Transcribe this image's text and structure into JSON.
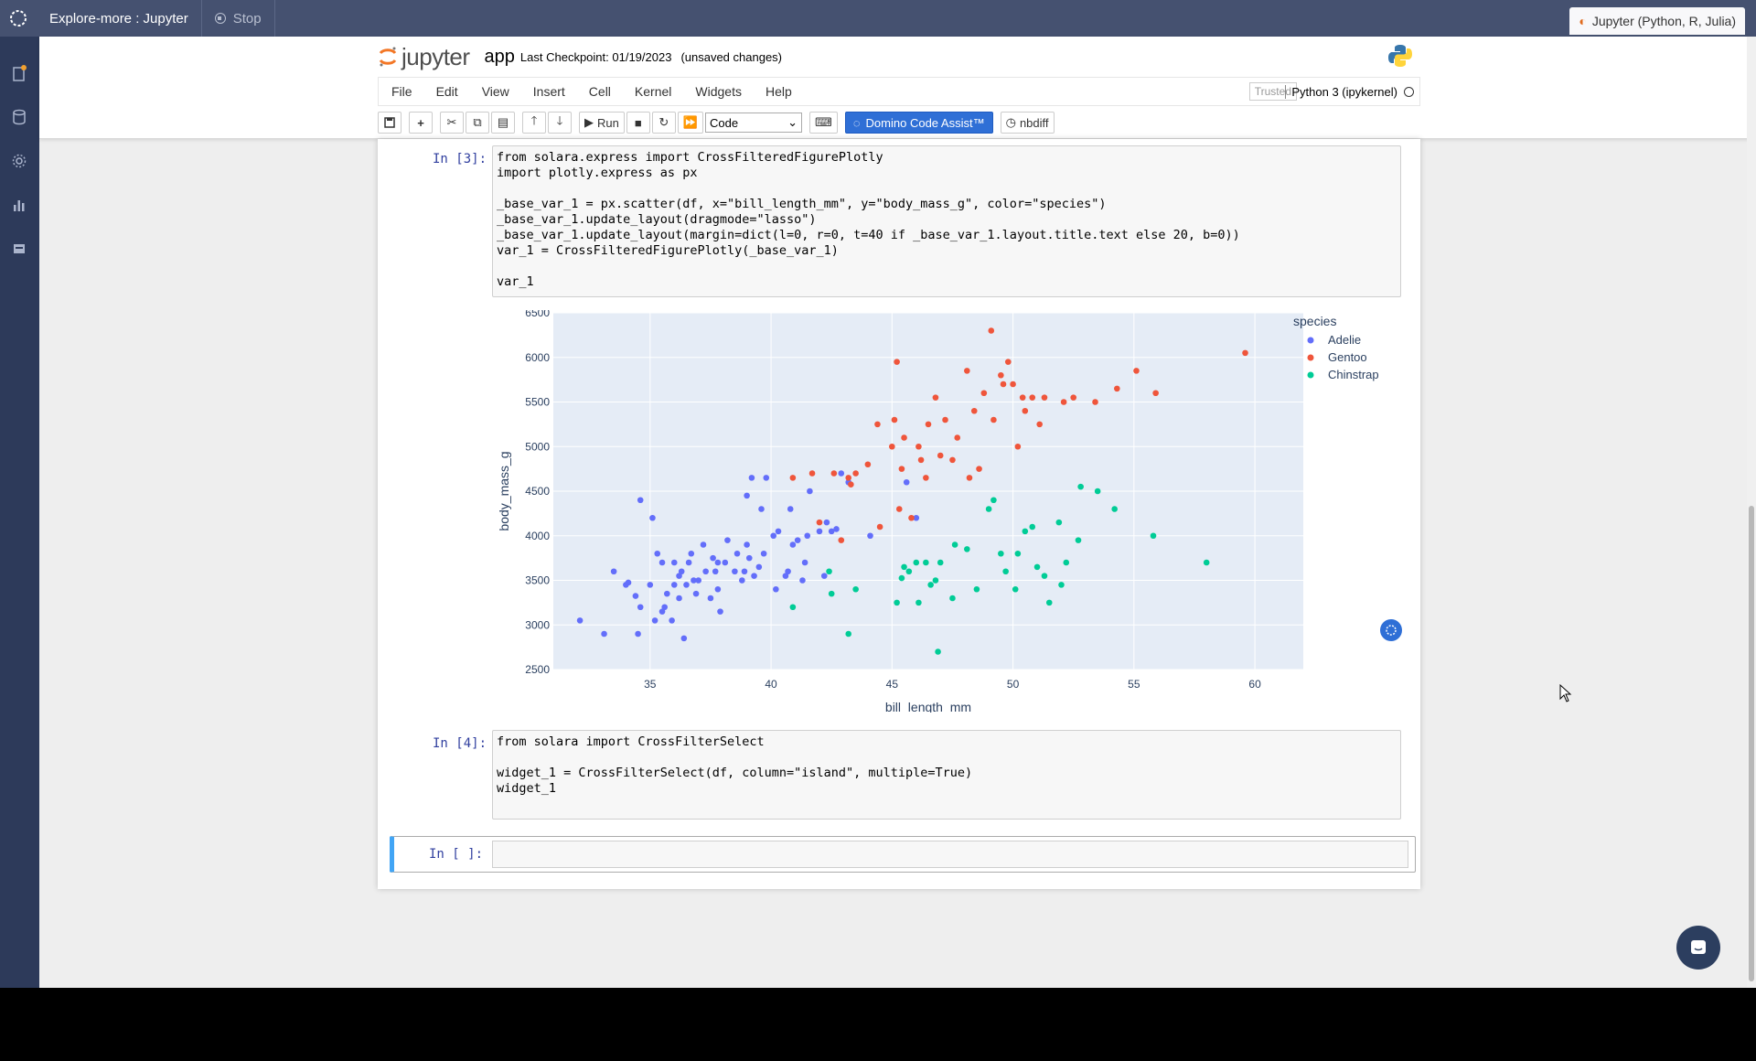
{
  "topbar": {
    "title": "Explore-more : Jupyter",
    "stop_label": "Stop",
    "env_label": "Jupyter (Python, R, Julia)"
  },
  "header": {
    "notebook_name": "app",
    "jupyter_text": "jupyter",
    "checkpoint": "Last Checkpoint: 01/19/2023",
    "status": "(unsaved changes)"
  },
  "menu": {
    "items": [
      "File",
      "Edit",
      "View",
      "Insert",
      "Cell",
      "Kernel",
      "Widgets",
      "Help"
    ],
    "trusted": "Trusted",
    "kernel": "Python 3 (ipykernel)"
  },
  "toolbar": {
    "run_label": "Run",
    "cell_type": "Code",
    "domino_label": "Domino Code Assist™",
    "nbdiff_label": "nbdiff"
  },
  "cells": [
    {
      "prompt": "In [3]:",
      "lines": [
        "from solara.express import CrossFilteredFigurePlotly",
        "import plotly.express as px",
        "",
        "_base_var_1 = px.scatter(df, x=\"bill_length_mm\", y=\"body_mass_g\", color=\"species\")",
        "_base_var_1.update_layout(dragmode=\"lasso\")",
        "_base_var_1.update_layout(margin=dict(l=0, r=0, t=40 if _base_var_1.layout.title.text else 20, b=0))",
        "var_1 = CrossFilteredFigurePlotly(_base_var_1)",
        "",
        "var_1"
      ]
    },
    {
      "prompt": "In [4]:",
      "lines": [
        "from solara import CrossFilterSelect",
        "",
        "widget_1 = CrossFilterSelect(df, column=\"island\", multiple=True)",
        "widget_1"
      ]
    },
    {
      "prompt": "In [ ]:",
      "lines": []
    }
  ],
  "chart_data": {
    "type": "scatter",
    "xlabel": "bill_length_mm",
    "ylabel": "body_mass_g",
    "xlim": [
      31,
      62
    ],
    "ylim": [
      2500,
      6500
    ],
    "xticks": [
      35,
      40,
      45,
      50,
      55,
      60
    ],
    "yticks": [
      2500,
      3000,
      3500,
      4000,
      4500,
      5000,
      5500,
      6000,
      6500
    ],
    "legend_title": "species",
    "legend_position": "right",
    "grid": true,
    "series": [
      {
        "name": "Adelie",
        "color": "#636efa",
        "points": [
          [
            32.1,
            3050
          ],
          [
            33.1,
            2900
          ],
          [
            33.5,
            3600
          ],
          [
            34.0,
            3450
          ],
          [
            34.1,
            3475
          ],
          [
            34.4,
            3325
          ],
          [
            34.5,
            2900
          ],
          [
            34.6,
            4400
          ],
          [
            34.6,
            3200
          ],
          [
            35.0,
            3450
          ],
          [
            35.1,
            4200
          ],
          [
            35.2,
            3050
          ],
          [
            35.3,
            3800
          ],
          [
            35.5,
            3700
          ],
          [
            35.5,
            3150
          ],
          [
            35.6,
            3200
          ],
          [
            35.7,
            3350
          ],
          [
            35.9,
            3050
          ],
          [
            36.0,
            3700
          ],
          [
            36.0,
            3450
          ],
          [
            36.2,
            3300
          ],
          [
            36.2,
            3550
          ],
          [
            36.3,
            3600
          ],
          [
            36.4,
            2850
          ],
          [
            36.5,
            3450
          ],
          [
            36.6,
            3700
          ],
          [
            36.7,
            3800
          ],
          [
            36.8,
            3500
          ],
          [
            36.9,
            3350
          ],
          [
            37.0,
            3500
          ],
          [
            37.2,
            3900
          ],
          [
            37.3,
            3600
          ],
          [
            37.5,
            3300
          ],
          [
            37.6,
            3750
          ],
          [
            37.7,
            3600
          ],
          [
            37.8,
            3700
          ],
          [
            37.8,
            3400
          ],
          [
            37.9,
            3150
          ],
          [
            38.1,
            3700
          ],
          [
            38.2,
            3950
          ],
          [
            38.5,
            3600
          ],
          [
            38.6,
            3800
          ],
          [
            38.8,
            3500
          ],
          [
            38.9,
            3600
          ],
          [
            39.0,
            3900
          ],
          [
            39.0,
            4450
          ],
          [
            39.1,
            3750
          ],
          [
            39.2,
            4650
          ],
          [
            39.3,
            3550
          ],
          [
            39.5,
            3650
          ],
          [
            39.6,
            4300
          ],
          [
            39.7,
            3800
          ],
          [
            39.8,
            4650
          ],
          [
            40.1,
            4000
          ],
          [
            40.2,
            3400
          ],
          [
            40.3,
            4050
          ],
          [
            40.6,
            3550
          ],
          [
            40.7,
            3600
          ],
          [
            40.8,
            4300
          ],
          [
            40.9,
            3900
          ],
          [
            41.1,
            3950
          ],
          [
            41.3,
            3500
          ],
          [
            41.4,
            3700
          ],
          [
            41.5,
            4000
          ],
          [
            41.6,
            4500
          ],
          [
            42.0,
            4050
          ],
          [
            42.2,
            3550
          ],
          [
            42.3,
            4150
          ],
          [
            42.5,
            4050
          ],
          [
            42.7,
            4075
          ],
          [
            42.9,
            4700
          ],
          [
            43.2,
            4600
          ],
          [
            44.1,
            4000
          ],
          [
            45.6,
            4600
          ],
          [
            46.0,
            4200
          ]
        ]
      },
      {
        "name": "Gentoo",
        "color": "#ef553b",
        "points": [
          [
            40.9,
            4650
          ],
          [
            41.7,
            4700
          ],
          [
            42.0,
            4150
          ],
          [
            42.6,
            4700
          ],
          [
            42.9,
            3950
          ],
          [
            43.2,
            4650
          ],
          [
            43.3,
            4575
          ],
          [
            43.5,
            4700
          ],
          [
            44.0,
            4800
          ],
          [
            44.4,
            5250
          ],
          [
            44.5,
            4100
          ],
          [
            45.0,
            5000
          ],
          [
            45.1,
            5300
          ],
          [
            45.2,
            5950
          ],
          [
            45.3,
            4300
          ],
          [
            45.4,
            4750
          ],
          [
            45.5,
            5100
          ],
          [
            45.8,
            4200
          ],
          [
            46.1,
            5000
          ],
          [
            46.2,
            4850
          ],
          [
            46.4,
            4650
          ],
          [
            46.5,
            5250
          ],
          [
            46.8,
            5550
          ],
          [
            47.0,
            4900
          ],
          [
            47.2,
            5300
          ],
          [
            47.5,
            4850
          ],
          [
            47.7,
            5100
          ],
          [
            48.1,
            5850
          ],
          [
            48.2,
            4650
          ],
          [
            48.4,
            5400
          ],
          [
            48.6,
            4750
          ],
          [
            48.8,
            5600
          ],
          [
            49.1,
            6300
          ],
          [
            49.2,
            5300
          ],
          [
            49.5,
            5800
          ],
          [
            49.6,
            5700
          ],
          [
            49.8,
            5950
          ],
          [
            50.0,
            5700
          ],
          [
            50.2,
            5000
          ],
          [
            50.4,
            5550
          ],
          [
            50.5,
            5400
          ],
          [
            50.8,
            5550
          ],
          [
            51.1,
            5250
          ],
          [
            51.3,
            5550
          ],
          [
            52.1,
            5500
          ],
          [
            52.5,
            5550
          ],
          [
            53.4,
            5500
          ],
          [
            54.3,
            5650
          ],
          [
            55.1,
            5850
          ],
          [
            55.9,
            5600
          ],
          [
            59.6,
            6050
          ]
        ]
      },
      {
        "name": "Chinstrap",
        "color": "#00cc96",
        "points": [
          [
            40.9,
            3200
          ],
          [
            42.4,
            3600
          ],
          [
            42.5,
            3350
          ],
          [
            43.2,
            2900
          ],
          [
            43.5,
            3400
          ],
          [
            45.2,
            3250
          ],
          [
            45.4,
            3525
          ],
          [
            45.5,
            3650
          ],
          [
            45.7,
            3600
          ],
          [
            46.0,
            3700
          ],
          [
            46.1,
            3250
          ],
          [
            46.4,
            3700
          ],
          [
            46.6,
            3450
          ],
          [
            46.8,
            3500
          ],
          [
            46.9,
            2700
          ],
          [
            47.0,
            3700
          ],
          [
            47.5,
            3300
          ],
          [
            47.6,
            3900
          ],
          [
            48.1,
            3850
          ],
          [
            48.5,
            3400
          ],
          [
            49.0,
            4300
          ],
          [
            49.2,
            4400
          ],
          [
            49.5,
            3800
          ],
          [
            49.7,
            3600
          ],
          [
            50.1,
            3400
          ],
          [
            50.2,
            3800
          ],
          [
            50.5,
            4050
          ],
          [
            50.8,
            4100
          ],
          [
            51.0,
            3650
          ],
          [
            51.3,
            3550
          ],
          [
            51.5,
            3250
          ],
          [
            51.9,
            4150
          ],
          [
            52.0,
            3450
          ],
          [
            52.2,
            3700
          ],
          [
            52.7,
            3950
          ],
          [
            52.8,
            4550
          ],
          [
            53.5,
            4500
          ],
          [
            54.2,
            4300
          ],
          [
            55.8,
            4000
          ],
          [
            58.0,
            3700
          ]
        ]
      }
    ]
  }
}
